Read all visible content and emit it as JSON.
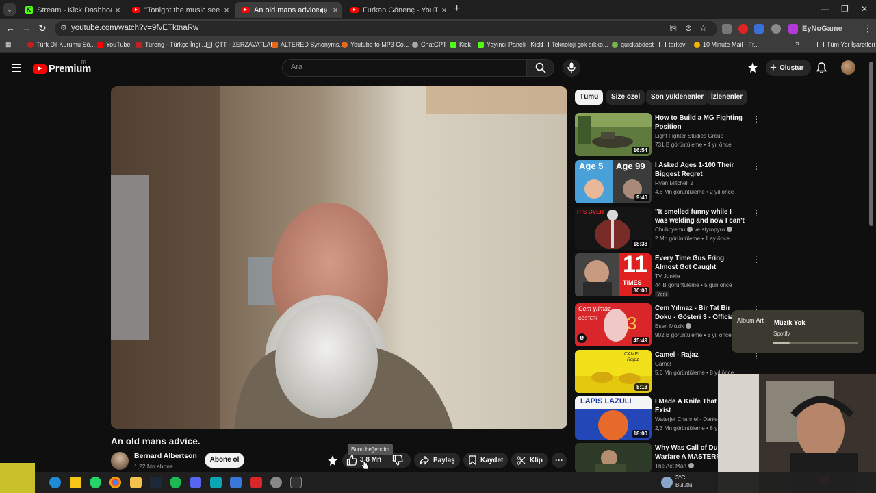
{
  "browser": {
    "tabs": [
      {
        "title": "Stream - Kick Dashboard",
        "icon": "kick-icon"
      },
      {
        "title": "\"Tonight the music seems so lo",
        "icon": "youtube-icon"
      },
      {
        "title": "An old mans advice. - YouT",
        "icon": "youtube-icon"
      },
      {
        "title": "Furkan Gönenç - YouTube",
        "icon": "youtube-icon"
      }
    ],
    "url": "youtube.com/watch?v=9fvETktnaRw",
    "profile_label": "EyNoGame",
    "bookmarks": [
      "Türk Dil Kurumu Sö...",
      "YouTube",
      "Tureng - Türkçe İngil...",
      "ÇTT - ZERZAVATLAR",
      "ALTERED Synonyms...",
      "Youtube to MP3 Co...",
      "ChatGPT",
      "Kick",
      "Yayıncı Paneli | Kick",
      "Teknoloji çok sıkko...",
      "quickabdest",
      "tarkov",
      "10 Minute Mail - Fr..."
    ],
    "all_bookmarks": "Tüm Yer İşaretleri"
  },
  "youtube": {
    "logo": "Premium",
    "country": "TR",
    "search_placeholder": "Ara",
    "create_label": "Oluştur"
  },
  "video": {
    "title": "An old mans advice.",
    "channel": "Bernard Albertson",
    "subscribers": "1,22 Mn abone",
    "subscribe_label": "Abone ol",
    "likes": "3,8 Mn",
    "like_tooltip": "Bunu beğendim",
    "share_label": "Paylaş",
    "save_label": "Kaydet",
    "clip_label": "Klip"
  },
  "chips": [
    "Tümü",
    "Size özel",
    "Son yüklenenler",
    "İzlenenler"
  ],
  "recommendations": [
    {
      "title": "How to Build a MG Fighting Position",
      "channel": "Light Fighter Studies Group",
      "views": "731 B görüntüleme",
      "age": "4 yıl önce",
      "duration": "16:54",
      "verified": false
    },
    {
      "title": "I Asked Ages 1-100 Their Biggest Regret",
      "channel": "Ryan Mitchell 2",
      "views": "4,6 Mn görüntüleme",
      "age": "2 yıl önce",
      "duration": "9:40",
      "verified": false
    },
    {
      "title": "\"It smelled funny while I was welding and now I can't ...",
      "channel": "Chubbyemu",
      "channel_extra": "ve styropyro",
      "views": "2 Mn görüntüleme",
      "age": "1 ay önce",
      "duration": "18:38",
      "verified": true
    },
    {
      "title": "Every Time Gus Fring Almost Got Caught",
      "channel": "TV Junkie",
      "views": "44 B görüntüleme",
      "age": "5 gün önce",
      "duration": "30:00",
      "badge": "Yeni",
      "verified": false
    },
    {
      "title": "Cem Yılmaz - Bir Tat Bir Doku - Gösteri 3 - Official Audio ...",
      "channel": "Esen Müzik",
      "views": "902 B görüntüleme",
      "age": "8 yıl önce",
      "duration": "45:49",
      "verified": true
    },
    {
      "title": "Camel - Rajaz",
      "channel": "Camel",
      "views": "5,6 Mn görüntüleme",
      "age": "8 yıl önce",
      "duration": "8:18",
      "verified": false
    },
    {
      "title": "I Made A Knife That Sh... Exist",
      "channel": "Waterjet Channel - Daniel",
      "views": "2,3 Mn görüntüleme",
      "age": "8 y",
      "duration": "18:00",
      "verified": false
    },
    {
      "title": "Why Was Call of Duty Warfare A MASTERPI...",
      "channel": "The Act Man",
      "views": "",
      "age": "",
      "duration": "",
      "verified": true
    }
  ],
  "thumb_texts": {
    "age5": "Age 5",
    "age99": "Age 99",
    "its_over": "IT'S OVER",
    "eleven": "11",
    "times": "TIMES",
    "cem": "Cem yılmaz",
    "gosteri": "GÖSTERİ",
    "three": "3",
    "e": "e",
    "camel": "CAMEL",
    "rajaz": "Rajaz",
    "lapis": "LAPIS LAZULI"
  },
  "spotify": {
    "album_art_alt": "Album Art",
    "track": "Müzik Yok",
    "source": "Spotify",
    "progress": 0.2
  },
  "taskbar": {
    "temperature": "3°C",
    "weather": "Bulutlu"
  },
  "colors": {
    "youtube_red": "#ff0000",
    "kick_green": "#53fc18",
    "background": "#0f0f0f"
  }
}
